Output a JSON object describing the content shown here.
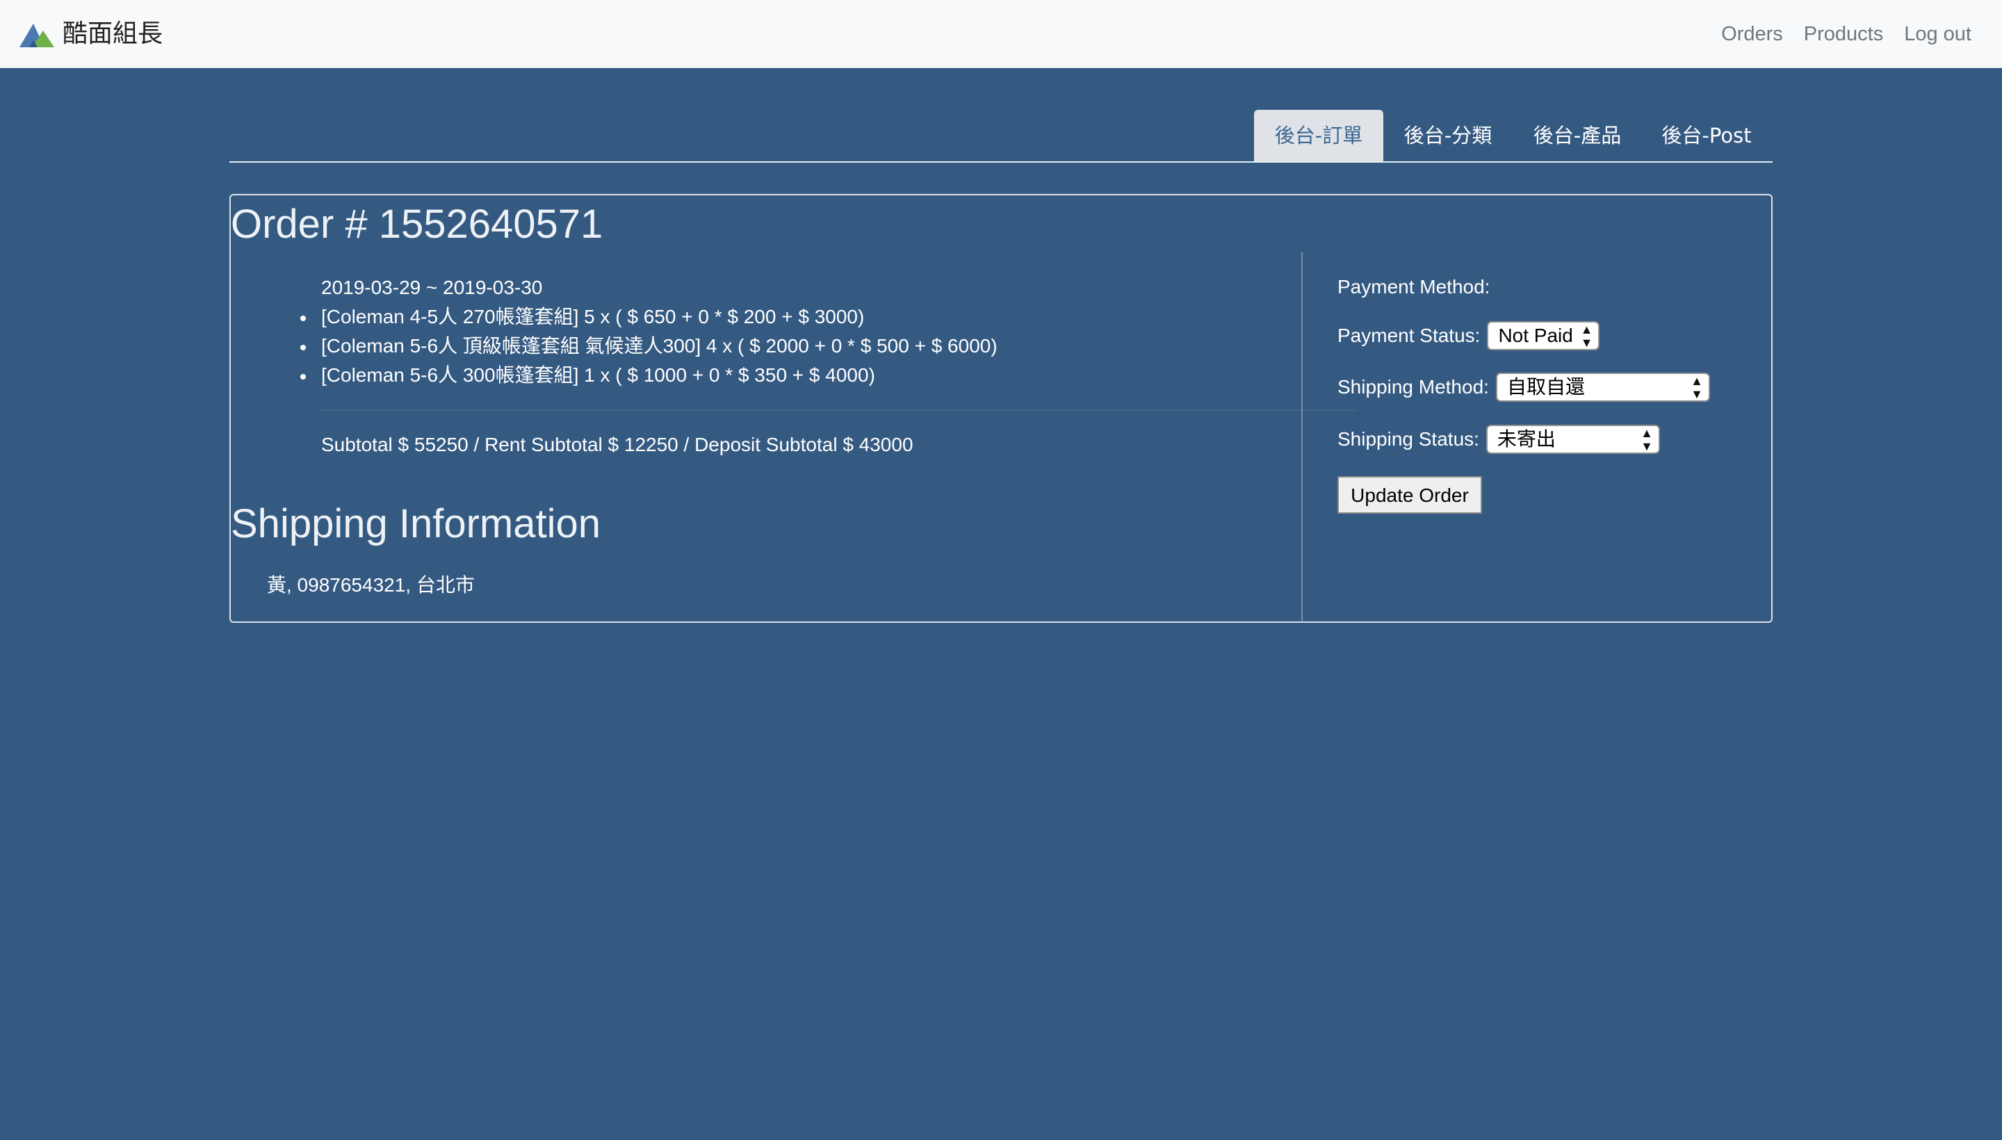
{
  "navbar": {
    "brand_name": "酷面組長",
    "links": [
      "Orders",
      "Products",
      "Log out"
    ]
  },
  "tabs": [
    {
      "label": "後台-訂單",
      "active": true
    },
    {
      "label": "後台-分類",
      "active": false
    },
    {
      "label": "後台-產品",
      "active": false
    },
    {
      "label": "後台-Post",
      "active": false
    }
  ],
  "order": {
    "title": "Order # 1552640571",
    "date_range": "2019-03-29 ~ 2019-03-30",
    "items": [
      "[Coleman 4-5人 270帳篷套組] 5 x ( $ 650 + 0 * $ 200 + $ 3000)",
      "[Coleman 5-6人 頂級帳篷套組 氣候達人300] 4 x ( $ 2000 + 0 * $ 500 + $ 6000)",
      "[Coleman 5-6人 300帳篷套組] 1 x ( $ 1000 + 0 * $ 350 + $ 4000)"
    ],
    "subtotal": "Subtotal $ 55250 / Rent Subtotal $ 12250 / Deposit Subtotal $ 43000"
  },
  "shipping": {
    "title": "Shipping Information",
    "info": "黃, 0987654321, 台北市"
  },
  "form": {
    "payment_method_label": "Payment Method:",
    "payment_status_label": "Payment Status:",
    "payment_status_value": "Not Paid",
    "shipping_method_label": "Shipping Method:",
    "shipping_method_value": "自取自還",
    "shipping_status_label": "Shipping Status:",
    "shipping_status_value": "未寄出",
    "update_button": "Update Order"
  },
  "colors": {
    "page_background": "#355a82",
    "navbar_background": "#f8f9fa",
    "active_tab_background": "#dfe3e8"
  }
}
